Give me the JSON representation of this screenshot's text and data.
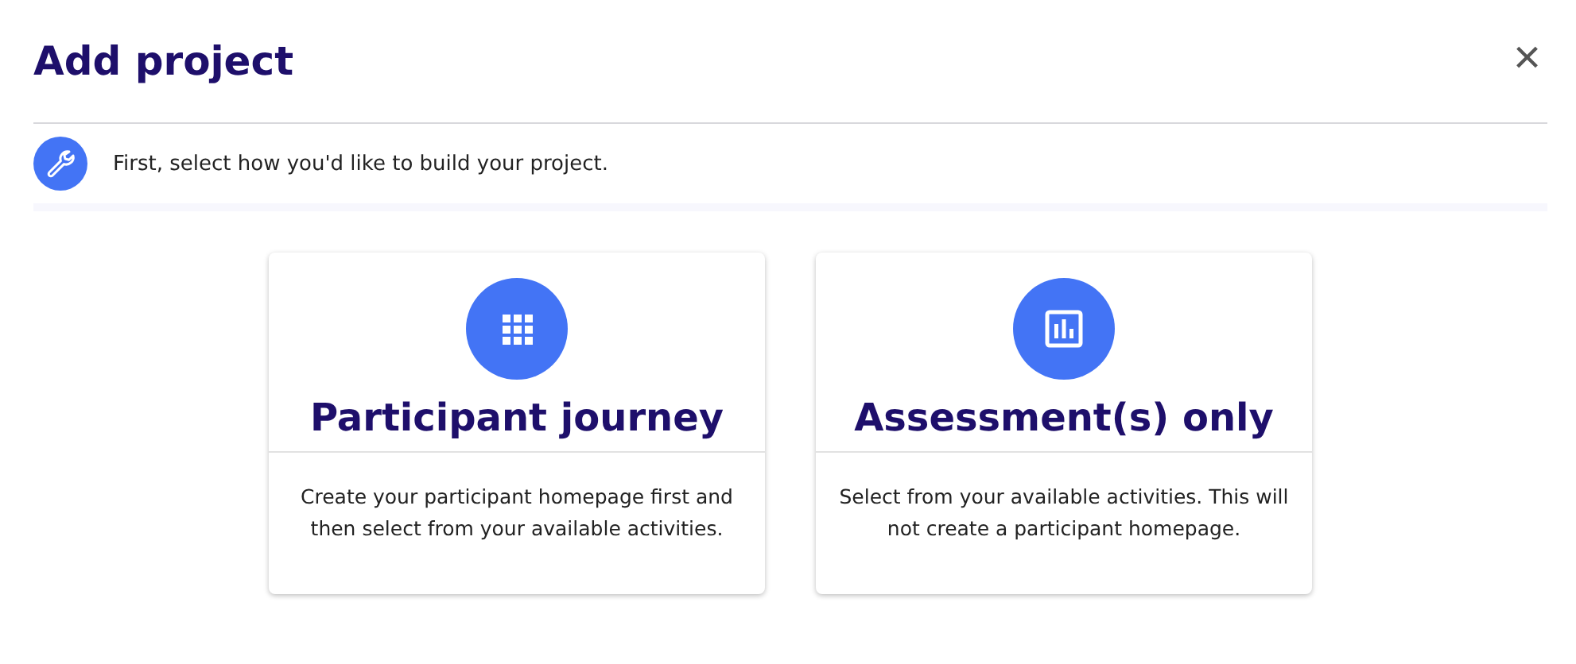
{
  "dialog": {
    "title": "Add project",
    "close_label": "×"
  },
  "banner": {
    "text": "First, select how you'd like to build your project."
  },
  "options": [
    {
      "kind": "grid",
      "title": "Participant journey",
      "description": "Create your participant homepage first and then select from your available activities."
    },
    {
      "kind": "chart",
      "title": "Assessment(s) only",
      "description": "Select from your available activities. This will not create a participant homepage."
    }
  ]
}
